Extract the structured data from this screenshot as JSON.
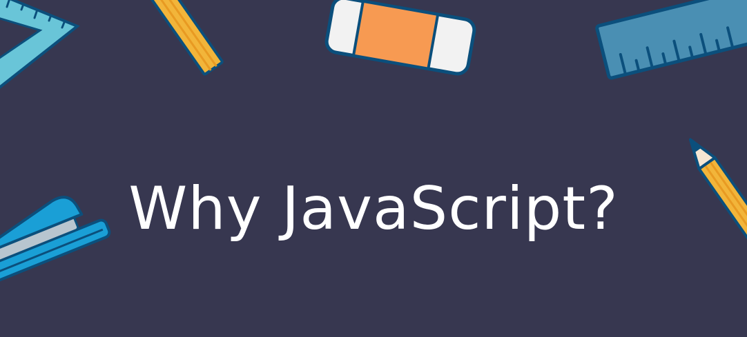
{
  "banner": {
    "title": "Why JavaScript?"
  },
  "colors": {
    "background": "#373750",
    "title_text": "#ffffff",
    "outline": "#0b4f7c",
    "eraser_band": "#f79a52",
    "eraser_body": "#f2f2f2",
    "ruler": "#4a8fb3",
    "set_square": "#69c5d8",
    "pencil_body": "#f2b53a",
    "stapler": "#1a9fd6"
  },
  "decorations": [
    {
      "name": "set-square-icon"
    },
    {
      "name": "pencil-icon"
    },
    {
      "name": "eraser-icon"
    },
    {
      "name": "ruler-icon"
    },
    {
      "name": "pencil-icon"
    },
    {
      "name": "stapler-icon"
    }
  ]
}
